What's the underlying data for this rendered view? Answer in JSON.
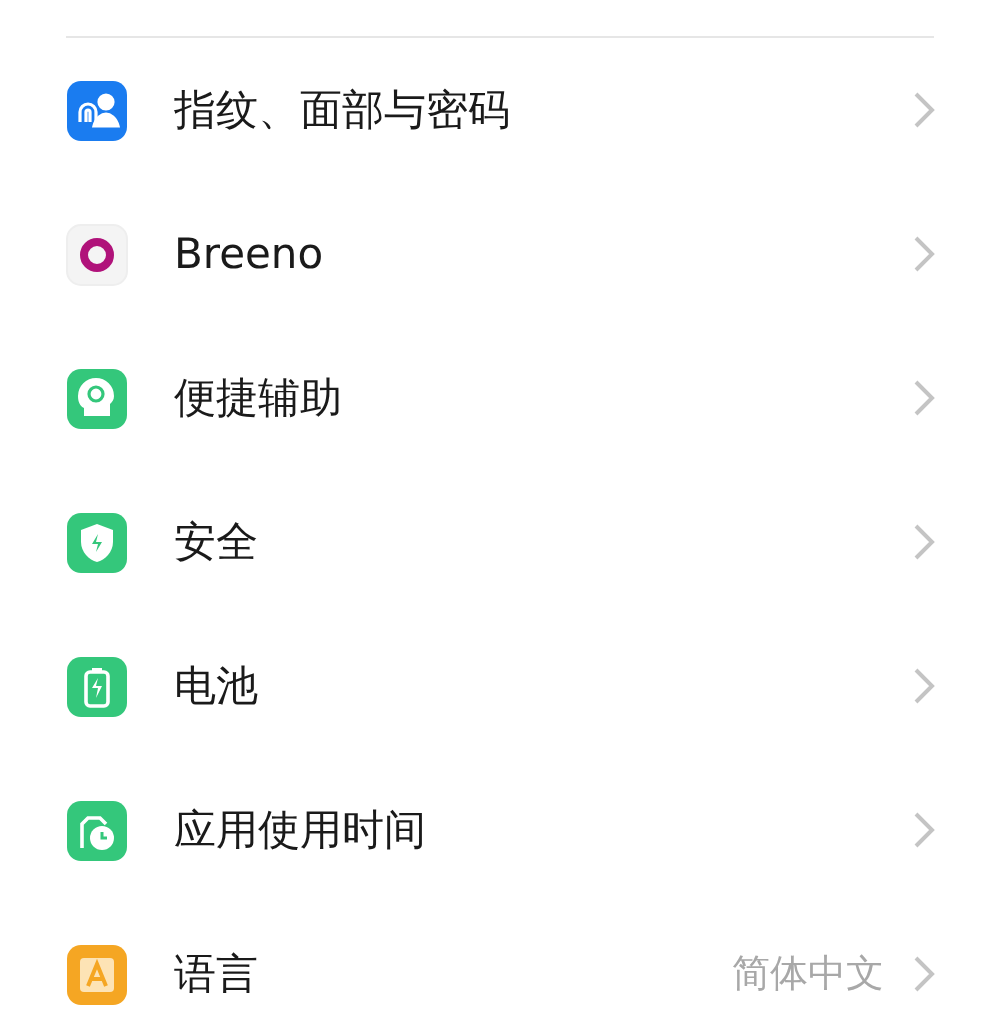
{
  "settings": [
    {
      "kind": "fingerprint",
      "color": "#1a7cf0",
      "label": "指纹、面部与密码"
    },
    {
      "kind": "breeno",
      "color": "#f4f4f4",
      "label": "Breeno"
    },
    {
      "kind": "accessibility",
      "color": "#34c77b",
      "label": "便捷辅助"
    },
    {
      "kind": "security",
      "color": "#34c77b",
      "label": "安全"
    },
    {
      "kind": "battery",
      "color": "#34c77b",
      "label": "电池"
    },
    {
      "kind": "apptime",
      "color": "#34c77b",
      "label": "应用使用时间"
    },
    {
      "kind": "language",
      "color": "#f5a623",
      "label": "语言",
      "value": "简体中文"
    }
  ]
}
